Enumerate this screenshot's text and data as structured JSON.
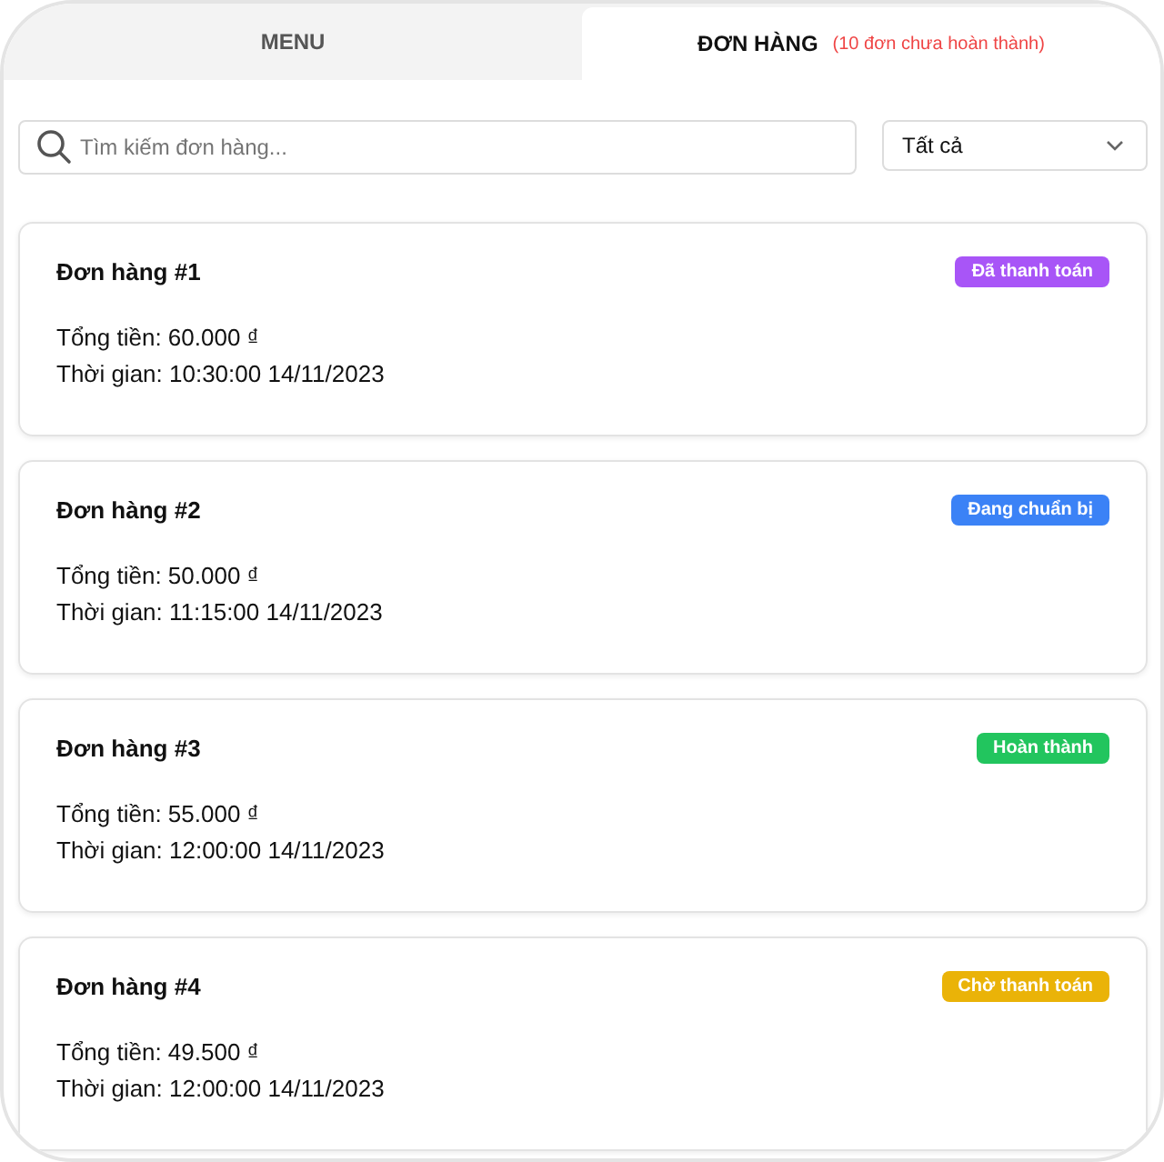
{
  "tabs": [
    {
      "label": "MENU",
      "selected": false
    },
    {
      "label": "ĐƠN HÀNG",
      "note": "(10 đơn chưa hoàn thành)",
      "selected": true
    }
  ],
  "search": {
    "placeholder": "Tìm kiếm đơn hàng..."
  },
  "filter": {
    "value": "Tất cả"
  },
  "orders": [
    {
      "title": "Đơn hàng #1",
      "status": "Đã thanh toán",
      "color": "#a855f7",
      "total": "Tổng tiền: 60.000 ₫",
      "time": "Thời gian: 10:30:00 14/11/2023"
    },
    {
      "title": "Đơn hàng #2",
      "status": "Đang chuẩn bị",
      "color": "#3b82f6",
      "total": "Tổng tiền: 50.000 ₫",
      "time": "Thời gian: 11:15:00 14/11/2023"
    },
    {
      "title": "Đơn hàng #3",
      "status": "Hoàn thành",
      "color": "#22c55e",
      "total": "Tổng tiền: 55.000 ₫",
      "time": "Thời gian: 12:00:00 14/11/2023"
    },
    {
      "title": "Đơn hàng #4",
      "status": "Chờ thanh toán",
      "color": "#eab308",
      "total": "Tổng tiền: 49.500 ₫",
      "time": "Thời gian: 12:00:00 14/11/2023"
    }
  ]
}
